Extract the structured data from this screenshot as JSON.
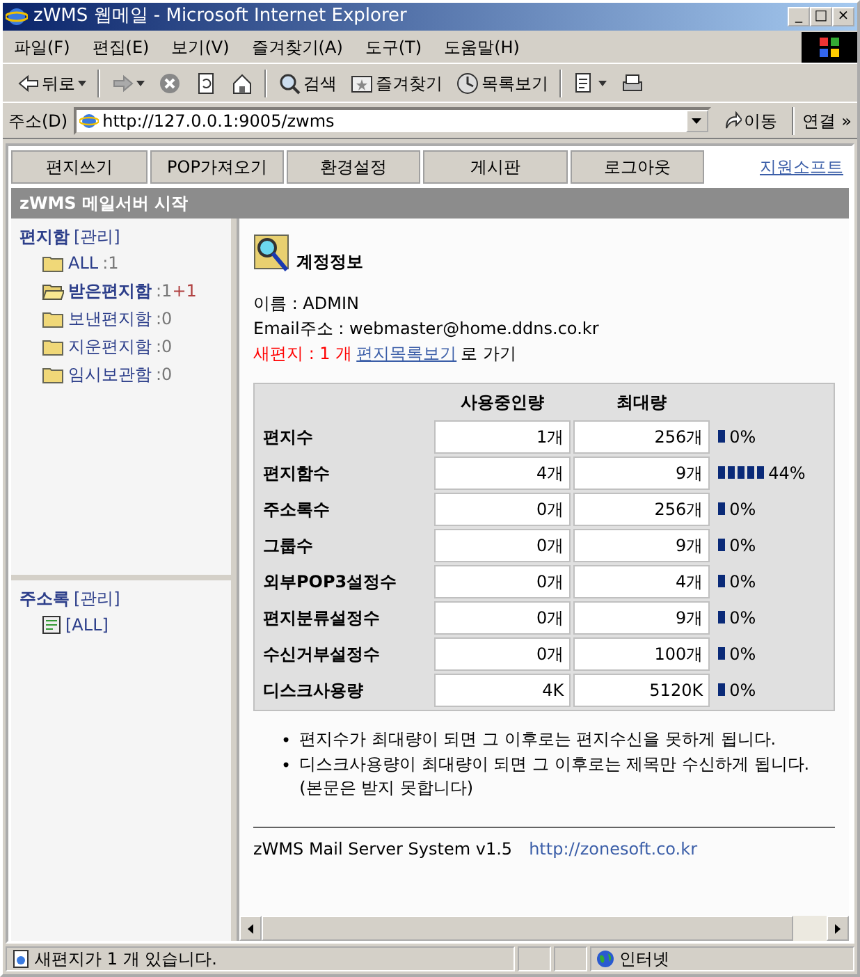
{
  "window": {
    "title": "zWMS 웹메일 - Microsoft Internet Explorer",
    "buttons": [
      "_",
      "□",
      "×"
    ]
  },
  "menu": [
    "파일(F)",
    "편집(E)",
    "보기(V)",
    "즐겨찾기(A)",
    "도구(T)",
    "도움말(H)"
  ],
  "toolbar": [
    {
      "kind": "back",
      "label": "뒤로"
    },
    {
      "kind": "forward"
    },
    {
      "kind": "stop"
    },
    {
      "kind": "refresh"
    },
    {
      "kind": "home"
    },
    {
      "kind": "search",
      "label": "검색"
    },
    {
      "kind": "favorites",
      "label": "즐겨찾기"
    },
    {
      "kind": "history",
      "label": "목록보기"
    },
    {
      "kind": "mail"
    },
    {
      "kind": "print"
    }
  ],
  "address": {
    "label": "주소(D)",
    "value": "http://127.0.0.1:9005/zwms",
    "go": "이동",
    "links": "연결",
    "chevron": "»"
  },
  "nav": {
    "buttons": [
      "편지쓰기",
      "POP가져오기",
      "환경설정",
      "게시판",
      "로그아웃"
    ],
    "link": "지원소프트"
  },
  "header": "zWMS 메일서버 시작",
  "mailboxes": {
    "title": "편지함",
    "manage": "[관리]",
    "folders": [
      {
        "name": "ALL",
        "count": ":1",
        "selected": false
      },
      {
        "name": "받은편지함",
        "count": ":1",
        "new": "+1",
        "selected": true
      },
      {
        "name": "보낸편지함",
        "count": ":0",
        "selected": false
      },
      {
        "name": "지운편지함",
        "count": ":0",
        "selected": false
      },
      {
        "name": "임시보관함",
        "count": ":0",
        "selected": false
      }
    ]
  },
  "address_book": {
    "title": "주소록",
    "manage": "[관리]",
    "items": [
      "[ALL]"
    ]
  },
  "account": {
    "title": "계정정보",
    "name": "이름 : ADMIN",
    "email": "Email주소 : webmaster@home.ddns.co.kr",
    "new_mail": "새편지 : 1 개",
    "list_link": "편지목록보기",
    "go_text": "로 가기"
  },
  "usage": {
    "columns": [
      "사용중인량",
      "최대량"
    ],
    "rows": [
      {
        "label": "편지수",
        "used": "1개",
        "max": "256개",
        "percent": "0%"
      },
      {
        "label": "편지함수",
        "used": "4개",
        "max": "9개",
        "percent": "44%"
      },
      {
        "label": "주소록수",
        "used": "0개",
        "max": "256개",
        "percent": "0%"
      },
      {
        "label": "그룹수",
        "used": "0개",
        "max": "9개",
        "percent": "0%"
      },
      {
        "label": "외부POP3설정수",
        "used": "0개",
        "max": "4개",
        "percent": "0%"
      },
      {
        "label": "편지분류설정수",
        "used": "0개",
        "max": "9개",
        "percent": "0%"
      },
      {
        "label": "수신거부설정수",
        "used": "0개",
        "max": "100개",
        "percent": "0%"
      },
      {
        "label": "디스크사용량",
        "used": "4K",
        "max": "5120K",
        "percent": "0%"
      }
    ]
  },
  "notes": [
    {
      "bullet": "•",
      "text": "편지수가 최대량이 되면 그 이후로는 편지수신을 못하게 됩니다."
    },
    {
      "bullet": "•",
      "text": "디스크사용량이 최대량이 되면 그 이후로는 제목만 수신하게 됩니다. (본문은 받지 못합니다)"
    }
  ],
  "footer": {
    "text": "zWMS Mail Server System v1.5",
    "link": "http://zonesoft.co.kr"
  },
  "status_bar": {
    "text": "새편지가 1 개 있습니다.",
    "zone": "인터넷"
  }
}
